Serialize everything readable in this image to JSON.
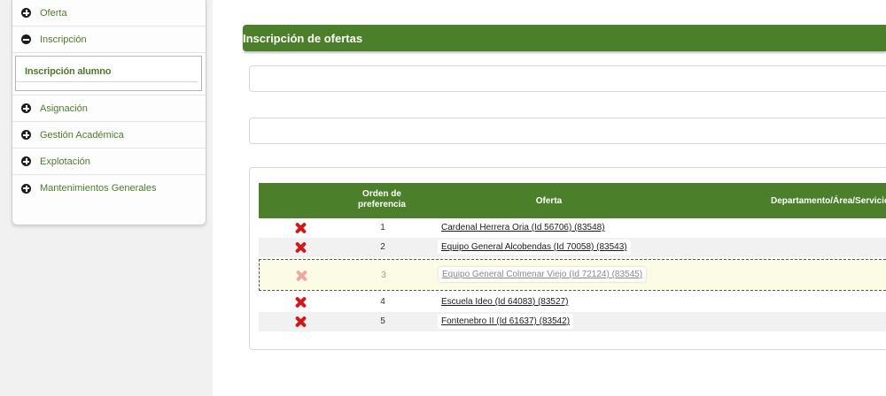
{
  "sidebar": {
    "items": [
      {
        "label": "Oferta",
        "state": "collapsed"
      },
      {
        "label": "Inscripción",
        "state": "expanded",
        "subitems": [
          "Inscripción alumno"
        ]
      },
      {
        "label": "Asignación",
        "state": "collapsed"
      },
      {
        "label": "Gestión Académica",
        "state": "collapsed"
      },
      {
        "label": "Explotación",
        "state": "collapsed"
      },
      {
        "label": "Mantenimientos Generales",
        "state": "collapsed"
      }
    ]
  },
  "main": {
    "title": "Inscripción de ofertas",
    "table": {
      "headers": {
        "orden": "Orden de preferencia",
        "oferta": "Oferta",
        "departamento": "Departamento/Área/Servicio"
      },
      "rows": [
        {
          "order": "1",
          "offer": "Cardenal Herrera Oria (Id 56706) (83548)"
        },
        {
          "order": "2",
          "offer": "Equipo General Alcobendas (Id 70058) (83543)"
        },
        {
          "order": "3",
          "offer": "Equipo General Colmenar Viejo (Id 72124) (83545)",
          "dragging": true
        },
        {
          "order": "4",
          "offer": "Escuela Ideo (Id 64083) (83527)"
        },
        {
          "order": "5",
          "offer": "Fontenebro II (Id 61637) (83542)"
        }
      ]
    }
  },
  "colors": {
    "accent_green": "#4b7f2a",
    "menu_text_green": "#4d7a2a",
    "delete_red": "#d91414",
    "drag_highlight": "#fbfbe6"
  },
  "icons": {
    "collapsed": "plus-circle-icon",
    "expanded": "minus-circle-icon",
    "delete": "red-x-icon"
  }
}
